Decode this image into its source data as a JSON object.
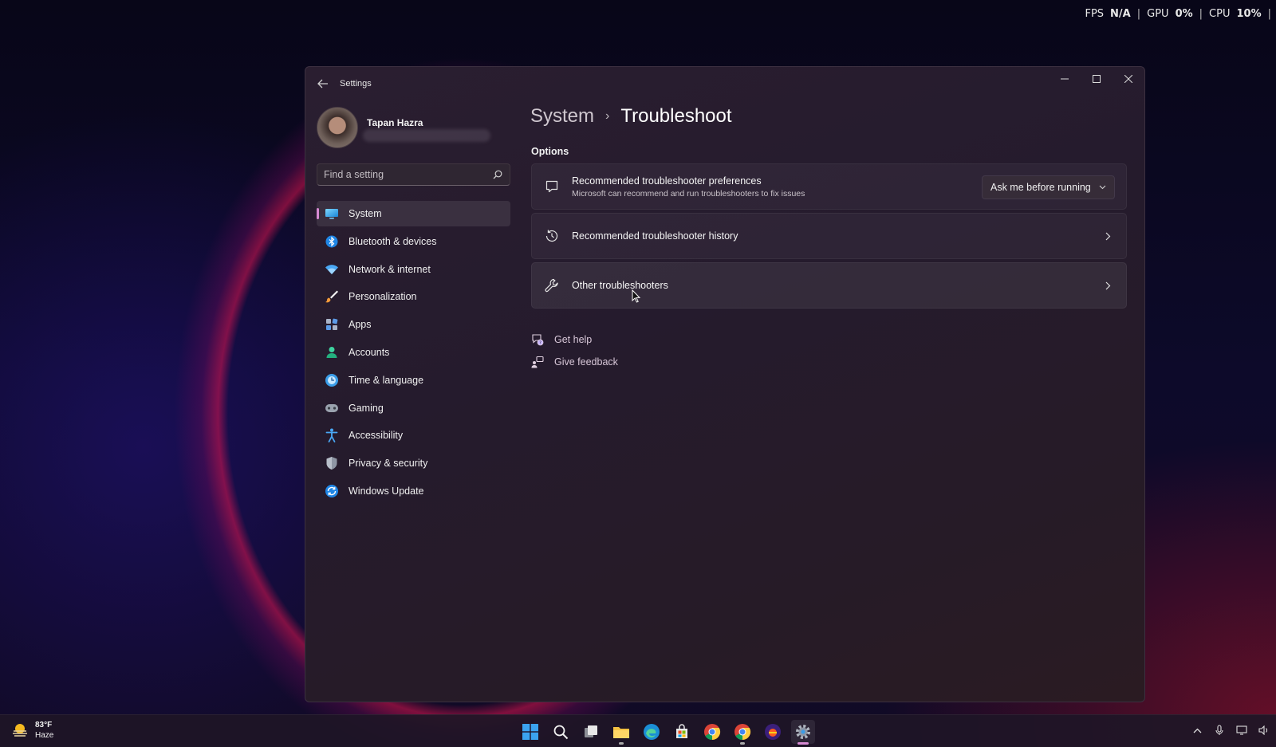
{
  "perf": {
    "fps_label": "FPS",
    "fps_value": "N/A",
    "gpu_label": "GPU",
    "gpu_value": "0%",
    "cpu_label": "CPU",
    "cpu_value": "10%",
    "sep": "|"
  },
  "window": {
    "title": "Settings",
    "controls": {
      "minimize": "−",
      "maximize": "□",
      "close": "✕"
    }
  },
  "profile": {
    "name": "Tapan Hazra"
  },
  "search": {
    "placeholder": "Find a setting"
  },
  "sidebar": {
    "items": [
      {
        "label": "System",
        "icon": "system-icon",
        "active": true
      },
      {
        "label": "Bluetooth & devices",
        "icon": "bluetooth-icon"
      },
      {
        "label": "Network & internet",
        "icon": "network-icon"
      },
      {
        "label": "Personalization",
        "icon": "personalization-icon"
      },
      {
        "label": "Apps",
        "icon": "apps-icon"
      },
      {
        "label": "Accounts",
        "icon": "accounts-icon"
      },
      {
        "label": "Time & language",
        "icon": "time-language-icon"
      },
      {
        "label": "Gaming",
        "icon": "gaming-icon"
      },
      {
        "label": "Accessibility",
        "icon": "accessibility-icon"
      },
      {
        "label": "Privacy & security",
        "icon": "privacy-shield-icon"
      },
      {
        "label": "Windows Update",
        "icon": "windows-update-icon"
      }
    ]
  },
  "main": {
    "breadcrumb": {
      "parent": "System",
      "separator": "›",
      "current": "Troubleshoot"
    },
    "section_label": "Options",
    "cards": [
      {
        "title": "Recommended troubleshooter preferences",
        "subtitle": "Microsoft can recommend and run troubleshooters to fix issues",
        "icon": "chat-bubble-icon",
        "dropdown_value": "Ask me before running"
      },
      {
        "title": "Recommended troubleshooter history",
        "icon": "history-icon"
      },
      {
        "title": "Other troubleshooters",
        "icon": "wrench-icon"
      }
    ],
    "links": [
      {
        "label": "Get help",
        "icon": "help-icon"
      },
      {
        "label": "Give feedback",
        "icon": "feedback-icon"
      }
    ]
  },
  "taskbar": {
    "weather": {
      "temp": "83°F",
      "condition": "Haze"
    }
  },
  "colors": {
    "accent": "#d68ad2",
    "window_bg": "#261c2d",
    "taskbar_bg": "#1e1626"
  }
}
